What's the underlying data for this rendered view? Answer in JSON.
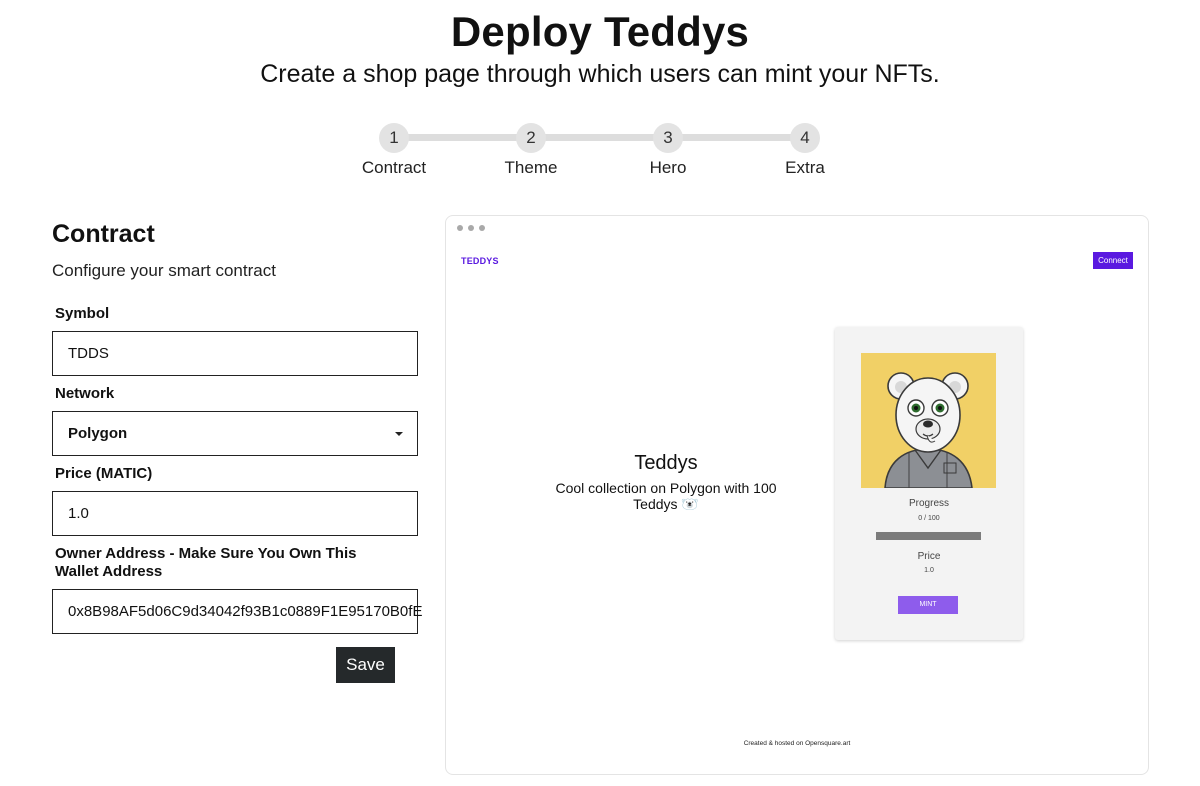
{
  "header": {
    "title": "Deploy Teddys",
    "subtitle": "Create a shop page through which users can mint your NFTs."
  },
  "stepper": {
    "steps": [
      {
        "number": "1",
        "label": "Contract"
      },
      {
        "number": "2",
        "label": "Theme"
      },
      {
        "number": "3",
        "label": "Hero"
      },
      {
        "number": "4",
        "label": "Extra"
      }
    ]
  },
  "form": {
    "title": "Contract",
    "description": "Configure your smart contract",
    "symbol": {
      "label": "Symbol",
      "value": "TDDS"
    },
    "network": {
      "label": "Network",
      "value": "Polygon"
    },
    "price": {
      "label": "Price (MATIC)",
      "value": "1.0"
    },
    "owner": {
      "label": "Owner Address - Make Sure You Own This Wallet Address",
      "value": "0x8B98AF5d06C9d34042f93B1c0889F1E95170B0fE"
    },
    "save_label": "Save"
  },
  "preview": {
    "brand": "TEDDYS",
    "connect_label": "Connect",
    "hero_title": "Teddys",
    "hero_description": "Cool collection on Polygon with 100 Teddys 🐻‍❄️",
    "card": {
      "progress_label": "Progress",
      "progress_value": "0 / 100",
      "progress_fraction": 0,
      "price_label": "Price",
      "price_value": "1.0",
      "mint_label": "MINT"
    },
    "footer": "Created & hosted on Opensquare.art"
  },
  "colors": {
    "accent": "#5a19e0",
    "mint_button": "#8e5cec",
    "save_button": "#25292b",
    "nft_background": "#f1d066"
  }
}
